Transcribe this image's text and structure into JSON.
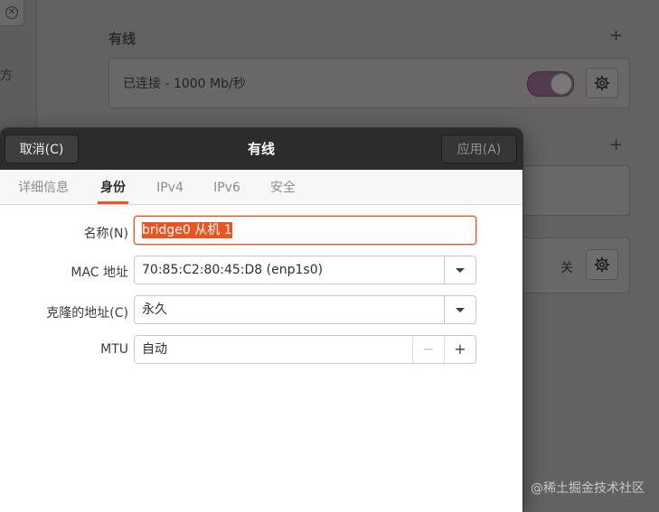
{
  "background": {
    "sidebar_partial_text": "方",
    "section_wired_title": "有线",
    "wired_connection_status": "已连接 - 1000 Mb/秒",
    "wired_toggle_on": true,
    "vpn_status_off": "关"
  },
  "dialog": {
    "title": "有线",
    "cancel_label": "取消(C)",
    "apply_label": "应用(A)",
    "tabs": [
      {
        "label": "详细信息",
        "active": false
      },
      {
        "label": "身份",
        "active": true
      },
      {
        "label": "IPv4",
        "active": false
      },
      {
        "label": "IPv6",
        "active": false
      },
      {
        "label": "安全",
        "active": false
      }
    ],
    "form": {
      "name_label": "名称(N)",
      "name_value": "bridge0 从机 1",
      "mac_label": "MAC 地址",
      "mac_value": "70:85:C2:80:45:D8 (enp1s0)",
      "clone_label": "克隆的地址(C)",
      "clone_value": "永久",
      "mtu_label": "MTU",
      "mtu_value": "自动",
      "minus": "−",
      "plus": "+"
    }
  },
  "watermark": "@稀土掘金技术社区",
  "colors": {
    "accent": "#e95420",
    "toggle": "#523a50",
    "header": "#2c2c2c"
  }
}
